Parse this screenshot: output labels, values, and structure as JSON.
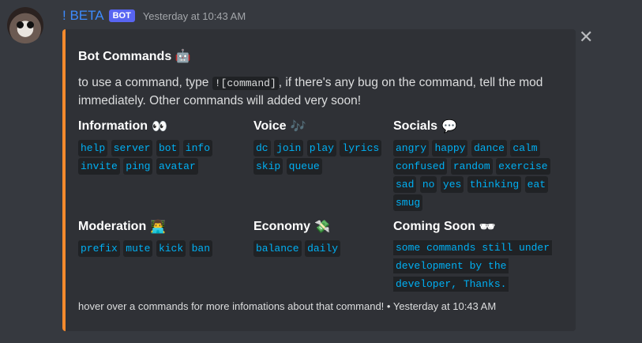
{
  "message": {
    "username": "! BETA",
    "bot_tag": "BOT",
    "timestamp": "Yesterday at 10:43 AM"
  },
  "embed": {
    "accent_color": "#f48a2d",
    "close_glyph": "✕",
    "title": "Bot Commands",
    "title_emoji": "🤖",
    "desc_before": "to use a command, type ",
    "desc_code": "![command]",
    "desc_after": ", if there's any bug on the command, tell the mod immediately. Other commands will added very soon!",
    "fields": {
      "information": {
        "name": "Information",
        "emoji": "👀",
        "items": [
          "help",
          "server",
          "bot",
          "info",
          "invite",
          "ping",
          "avatar"
        ]
      },
      "voice": {
        "name": "Voice",
        "emoji": "🎶",
        "items": [
          "dc",
          "join",
          "play",
          "lyrics",
          "skip",
          "queue"
        ]
      },
      "socials": {
        "name": "Socials",
        "emoji": "💬",
        "items": [
          "angry",
          "happy",
          "dance",
          "calm",
          "confused",
          "random",
          "exercise",
          "sad",
          "no",
          "yes",
          "thinking",
          "eat",
          "smug"
        ]
      },
      "moderation": {
        "name": "Moderation",
        "emoji": "👨‍💻",
        "items": [
          "prefix",
          "mute",
          "kick",
          "ban"
        ]
      },
      "economy": {
        "name": "Economy",
        "emoji": "💸",
        "items": [
          "balance",
          "daily"
        ]
      },
      "coming_soon": {
        "name": "Coming Soon",
        "emoji": "🕶",
        "text_lines": [
          "some commands still under",
          "development by the",
          "developer, Thanks."
        ]
      }
    },
    "footer": "hover over a commands for more infomations about that command! • Yesterday at 10:43 AM"
  }
}
